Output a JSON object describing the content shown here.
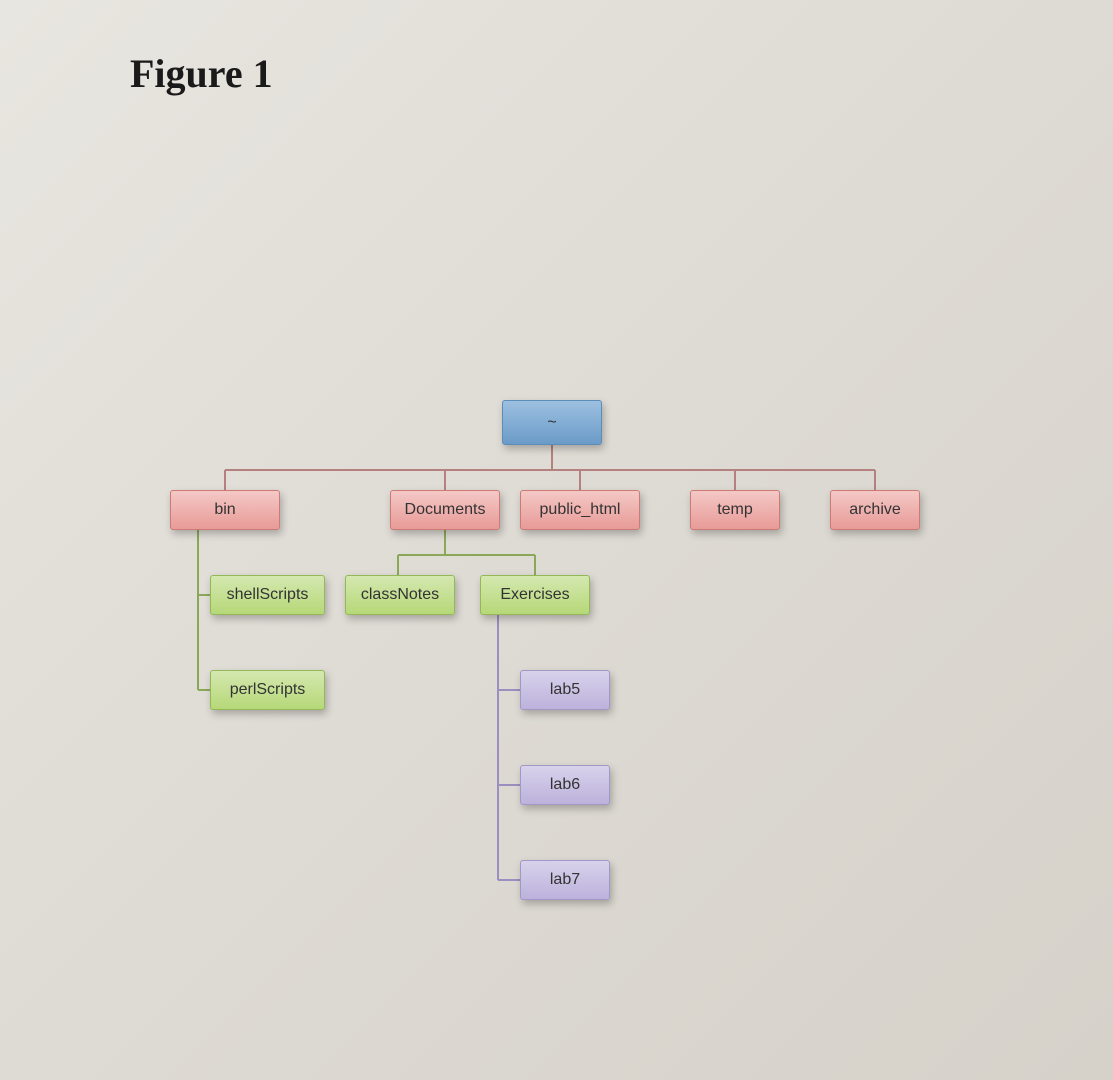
{
  "title": "Figure 1",
  "root": {
    "label": "~"
  },
  "level1": {
    "bin": "bin",
    "documents": "Documents",
    "public_html": "public_html",
    "temp": "temp",
    "archive": "archive"
  },
  "bin_children": {
    "shellScripts": "shellScripts",
    "perlScripts": "perlScripts"
  },
  "documents_children": {
    "classNotes": "classNotes",
    "exercises": "Exercises"
  },
  "exercises_children": {
    "lab5": "lab5",
    "lab6": "lab6",
    "lab7": "lab7"
  }
}
